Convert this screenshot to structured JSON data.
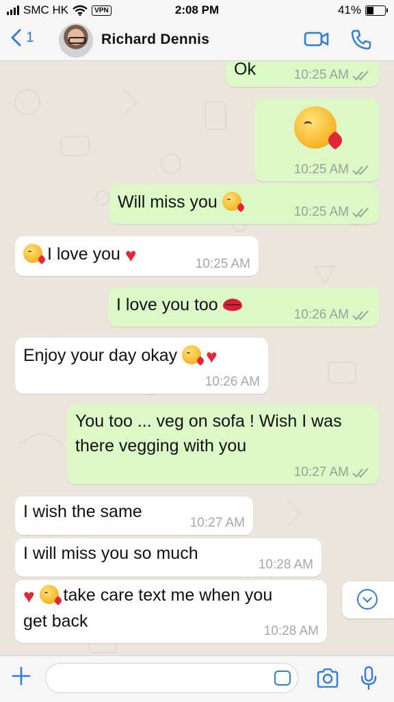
{
  "status_bar": {
    "carrier": "SMC HK",
    "vpn": "VPN",
    "time": "2:08 PM",
    "battery": "41%",
    "battery_level": 0.41
  },
  "header": {
    "back_count": "1",
    "contact_name": "Richard  Dennis",
    "icons": [
      "chevron-left-icon",
      "video-call-icon",
      "phone-call-icon"
    ]
  },
  "messages": [
    {
      "dir": "out",
      "text": "Ok",
      "time": "10:25 AM",
      "read": true
    },
    {
      "dir": "out",
      "text": "😘",
      "time": "10:25 AM",
      "read": true,
      "emoji_only": true
    },
    {
      "dir": "out",
      "text": "Will miss you",
      "emoji_after": "😘",
      "time": "10:25 AM",
      "read": true
    },
    {
      "dir": "in",
      "emoji_before": "😘",
      "text": "I love you",
      "emoji_after": "❤️",
      "time": "10:25 AM"
    },
    {
      "dir": "out",
      "text": "I love you too",
      "emoji_after": "💋",
      "time": "10:26 AM",
      "read": true
    },
    {
      "dir": "in",
      "text": "Enjoy your day okay",
      "emoji_after": "😘 ❤️",
      "time": "10:26 AM"
    },
    {
      "dir": "out",
      "line1": "You too ... veg on sofa ! Wish I was",
      "line2": "there vegging with  you",
      "time": "10:27 AM",
      "read": true
    },
    {
      "dir": "in",
      "text": "I wish the same",
      "time": "10:27 AM"
    },
    {
      "dir": "in",
      "text": "I will miss you so much",
      "time": "10:28 AM"
    },
    {
      "dir": "in",
      "emoji_before": "❤️😘",
      "line1": "take care text me when you",
      "line2": "get back",
      "time": "10:28 AM"
    }
  ],
  "input": {
    "value": "",
    "placeholder": ""
  },
  "colors": {
    "accent": "#2f7bd6",
    "outgoing_bubble": "#dcf8c6",
    "incoming_bubble": "#ffffff",
    "chat_bg": "#ece5dd"
  }
}
